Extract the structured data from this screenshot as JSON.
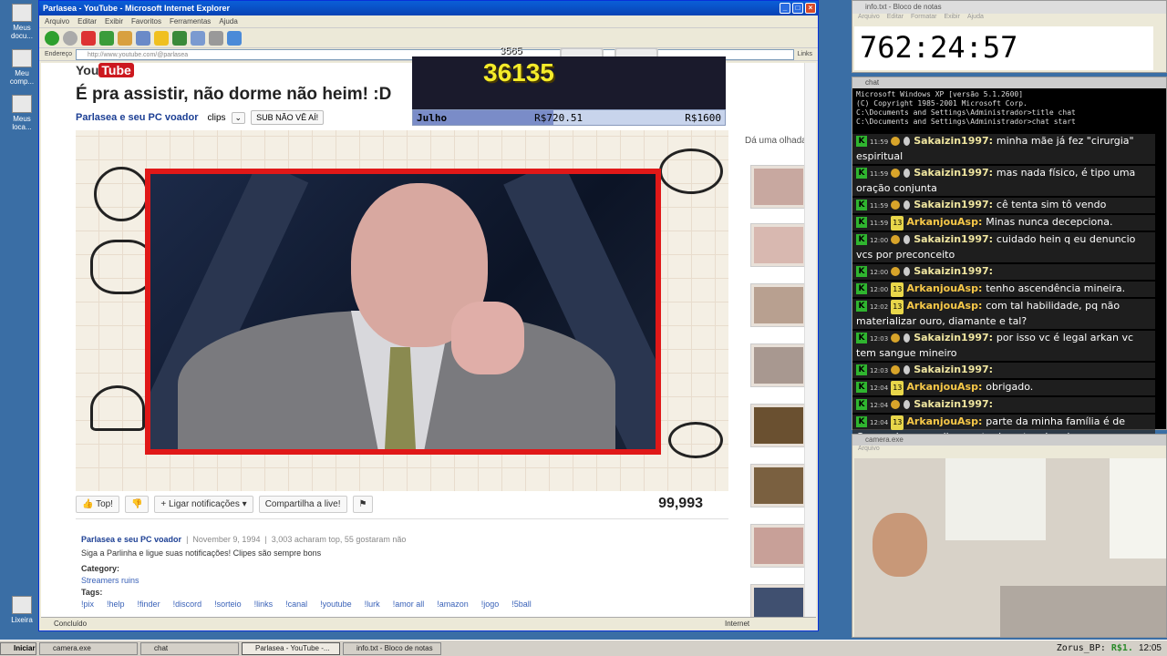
{
  "desktop": {
    "icons": [
      {
        "label": "Meus docu..."
      },
      {
        "label": "Meu comp..."
      },
      {
        "label": "Meus loca..."
      },
      {
        "label": "Lixeira"
      }
    ]
  },
  "ie": {
    "title": "Parlasea - YouTube - Microsoft Internet Explorer",
    "menu": [
      "Arquivo",
      "Editar",
      "Exibir",
      "Favoritos",
      "Ferramentas",
      "Ajuda"
    ],
    "address_label": "Endereço",
    "address": "http://www.youtube.com/@parlasea",
    "links_label": "Links",
    "status": "Concluído",
    "zone": "Internet"
  },
  "youtube": {
    "logo_you": "You",
    "logo_tube": "Tube",
    "title": "É pra assistir, não dorme não heim! :D",
    "channel": "Parlasea e seu PC voador",
    "clips": "clips",
    "sub_button": "SUB NÃO VÊ AÍ!",
    "like_button": "Top!",
    "notify_button": "Ligar notificações",
    "share_button": "Compartilha a live!",
    "views": "99,993",
    "desc_channel": "Parlasea e seu PC voador",
    "desc_date": "November 9, 1994",
    "desc_likes": "3,003 acharam top, 55 gostaram não",
    "desc_text": "Siga a Parlinha e ligue suas notificações! Clipes são sempre bons",
    "category_label": "Category:",
    "category": "Streamers ruins",
    "tags_label": "Tags:",
    "tags": [
      "!pix",
      "!help",
      "!finder",
      "!discord",
      "!sorteio",
      "!links",
      "!canal",
      "!youtube",
      "!lurk",
      "!amor all",
      "!amazon",
      "!jogo",
      "!5ball"
    ],
    "sidebar_heading": "Dá uma olhada"
  },
  "overlay": {
    "gold_value": "36135",
    "gold_small": "3565",
    "goal_name": "Julho",
    "goal_current": "R$720.51",
    "goal_target": "R$1600",
    "goal_fraction": 0.45
  },
  "notepad": {
    "title": "info.txt - Bloco de notas",
    "menu": [
      "Arquivo",
      "Editar",
      "Formatar",
      "Exibir",
      "Ajuda"
    ],
    "text": "762:24:57"
  },
  "chat": {
    "title": "chat",
    "cmd_lines": [
      "Microsoft Windows XP [versão 5.1.2600]",
      "(C) Copyright 1985-2001 Microsoft Corp.",
      "",
      "C:\\Documents and Settings\\Administrador>title chat",
      "",
      "C:\\Documents and Settings\\Administrador>chat start"
    ],
    "messages": [
      {
        "time": "11:59",
        "user": "Sakaizin1997",
        "text": "minha mãe já fez \"cirurgia\" espiritual",
        "kind": "sk"
      },
      {
        "time": "11:59",
        "user": "Sakaizin1997",
        "text": "mas nada físico, é tipo uma oração conjunta",
        "kind": "sk"
      },
      {
        "time": "11:59",
        "user": "Sakaizin1997",
        "text": "cê tenta sim tô vendo",
        "kind": "sk"
      },
      {
        "time": "11:59",
        "user": "ArkanjouAsp",
        "text": "Minas nunca decepciona.",
        "kind": "ar"
      },
      {
        "time": "12:00",
        "user": "Sakaizin1997",
        "text": "cuidado hein q eu denuncio vcs por preconceito",
        "kind": "sk"
      },
      {
        "time": "12:00",
        "user": "Sakaizin1997",
        "text": "",
        "kind": "sk"
      },
      {
        "time": "12:00",
        "user": "ArkanjouAsp",
        "text": "tenho ascendência mineira.",
        "kind": "ar"
      },
      {
        "time": "12:02",
        "user": "ArkanjouAsp",
        "text": "com tal habilidade, pq não materializar ouro, diamante e tal?",
        "kind": "ar"
      },
      {
        "time": "12:03",
        "user": "Sakaizin1997",
        "text": "por isso vc é legal arkan vc tem sangue mineiro",
        "kind": "sk"
      },
      {
        "time": "12:03",
        "user": "Sakaizin1997",
        "text": "",
        "kind": "sk"
      },
      {
        "time": "12:04",
        "user": "ArkanjouAsp",
        "text": "obrigado.",
        "kind": "ar"
      },
      {
        "time": "12:04",
        "user": "Sakaizin1997",
        "text": "",
        "kind": "sk"
      },
      {
        "time": "12:04",
        "user": "ArkanjouAsp",
        "text": "parte da minha família é de Carmo do paranaiba, perto de patos de minas.",
        "kind": "ar"
      }
    ]
  },
  "camera": {
    "title": "camera.exe",
    "menu": "Arquivo"
  },
  "taskbar": {
    "start": "Iniciar",
    "tasks": [
      "camera.exe",
      "chat",
      "Parlasea - YouTube -...",
      "info.txt - Bloco de notas"
    ],
    "tray_user": "Zorus_BP:",
    "tray_amount": "R$1.",
    "clock": "12:05"
  },
  "colors": {
    "ie_title": "#0a5fd8",
    "yt_red": "#cc181e",
    "video_border": "#e01818",
    "chat_green": "#2fb52f",
    "gold_text": "#f5ec2a"
  }
}
